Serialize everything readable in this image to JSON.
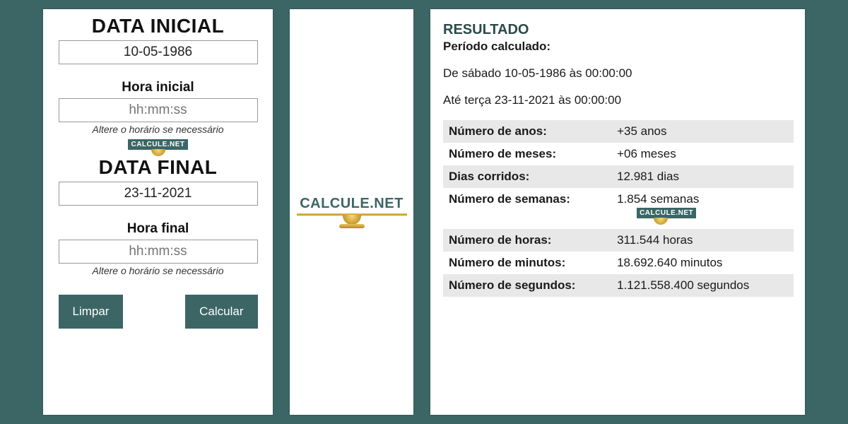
{
  "brand": "CALCULE.NET",
  "form": {
    "title_initial": "DATA INICIAL",
    "date_initial": "10-05-1986",
    "time_initial_label": "Hora inicial",
    "time_placeholder": "hh:mm:ss",
    "time_hint": "Altere o horário se necessário",
    "title_final": "DATA FINAL",
    "date_final": "23-11-2021",
    "time_final_label": "Hora final",
    "btn_clear": "Limpar",
    "btn_calc": "Calcular"
  },
  "result": {
    "heading": "RESULTADO",
    "period_label": "Período calculado:",
    "from_line": "De sábado 10-05-1986 às 00:00:00",
    "to_line": "Até terça 23-11-2021 às 00:00:00",
    "rows": {
      "years_label": "Número de anos:",
      "years_value": "+35 anos",
      "months_label": "Número de meses:",
      "months_value": "+06 meses",
      "days_label": "Dias corridos:",
      "days_value": "12.981 dias",
      "weeks_label": "Número de semanas:",
      "weeks_value": "1.854 semanas",
      "hours_label": "Número de horas:",
      "hours_value": "311.544 horas",
      "minutes_label": "Número de minutos:",
      "minutes_value": "18.692.640 minutos",
      "seconds_label": "Número de segundos:",
      "seconds_value": "1.121.558.400 segundos"
    }
  }
}
